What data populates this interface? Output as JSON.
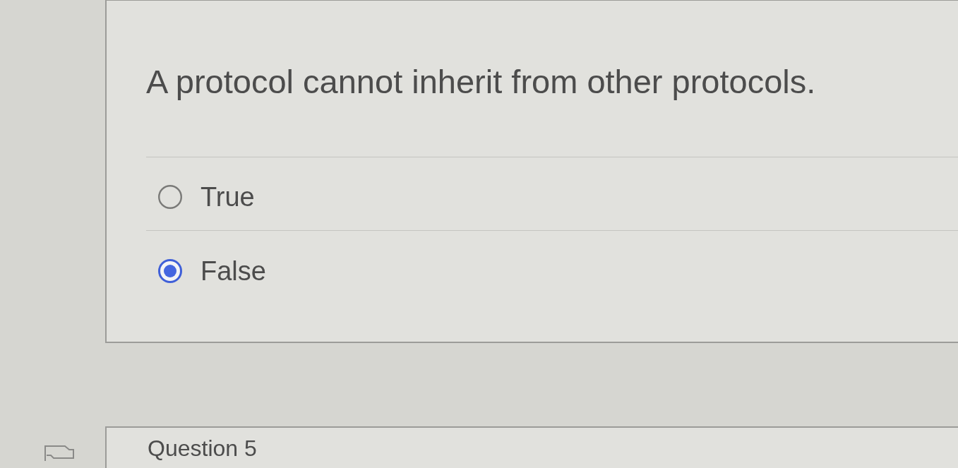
{
  "question": {
    "text": "A protocol cannot inherit from other protocols.",
    "options": [
      {
        "label": "True",
        "selected": false
      },
      {
        "label": "False",
        "selected": true
      }
    ]
  },
  "next_question": {
    "title": "Question 5"
  }
}
